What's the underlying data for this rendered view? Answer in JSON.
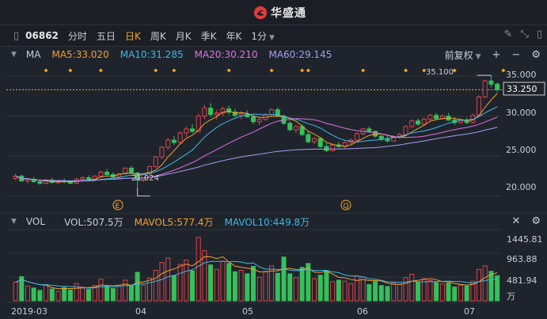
{
  "brand": {
    "name": "华盛通",
    "logo_icon": "huasheng-logo-icon"
  },
  "toolbar": {
    "code": "06862",
    "periods": [
      "分时",
      "五日",
      "日K",
      "周K",
      "月K",
      "季K",
      "年K"
    ],
    "active_period": "日K",
    "minute_select": "1分",
    "icons": [
      "pencil-icon",
      "fullscreen-icon",
      "expand-icon"
    ]
  },
  "main_panel": {
    "indicator": "MA",
    "ma": [
      {
        "label": "MA5:33.020",
        "color": "#f0a030"
      },
      {
        "label": "MA10:31.285",
        "color": "#3db8e8"
      },
      {
        "label": "MA20:30.210",
        "color": "#e36ee3"
      },
      {
        "label": "MA60:29.145",
        "color": "#a39cf0"
      }
    ],
    "adjust": "前复权",
    "y_ticks": [
      "35.000",
      "30.000",
      "25.000",
      "20.000"
    ],
    "current_price": "33.250",
    "high_label": "35.100",
    "low_label": "21.024",
    "event_markers": [
      "E",
      "Q"
    ]
  },
  "volume_panel": {
    "indicator": "VOL",
    "vol": {
      "label": "VOL:507.5万",
      "color": "#c9cdd4"
    },
    "mavol5": {
      "label": "MAVOL5:577.4万",
      "color": "#f0a030"
    },
    "mavol10": {
      "label": "MAVOL10:449.8万",
      "color": "#3db8e8"
    },
    "y_ticks": [
      "1445.81",
      "963.88",
      "481.94"
    ],
    "unit": "万"
  },
  "x_axis": {
    "labels": [
      "2019-03",
      "04",
      "05",
      "06",
      "07"
    ]
  },
  "colors": {
    "up": "#e0434c",
    "down": "#35c05a",
    "background": "#1f242c",
    "orange": "#f5a623"
  },
  "chart_data": {
    "type": "candlestick",
    "ylim": [
      18.0,
      36.6
    ],
    "candles": [
      [
        22.2,
        22.8,
        22.0,
        22.5
      ],
      [
        22.5,
        22.7,
        21.8,
        21.9
      ],
      [
        21.9,
        22.3,
        21.6,
        22.1
      ],
      [
        22.1,
        22.4,
        21.7,
        21.8
      ],
      [
        21.8,
        22.1,
        21.4,
        21.6
      ],
      [
        21.6,
        22.2,
        21.5,
        22.0
      ],
      [
        22.0,
        22.3,
        21.6,
        21.7
      ],
      [
        21.7,
        22.0,
        21.5,
        21.9
      ],
      [
        21.9,
        22.2,
        21.6,
        21.8
      ],
      [
        21.8,
        22.0,
        21.5,
        21.6
      ],
      [
        21.6,
        22.3,
        21.5,
        22.1
      ],
      [
        22.1,
        22.5,
        21.9,
        22.3
      ],
      [
        22.3,
        22.6,
        22.0,
        22.1
      ],
      [
        22.1,
        22.6,
        22.0,
        22.5
      ],
      [
        22.5,
        23.2,
        22.4,
        23.0
      ],
      [
        23.0,
        23.4,
        22.6,
        22.7
      ],
      [
        22.7,
        23.0,
        22.2,
        22.4
      ],
      [
        22.4,
        22.9,
        22.2,
        22.8
      ],
      [
        22.8,
        23.6,
        22.7,
        23.5
      ],
      [
        23.5,
        23.8,
        22.8,
        22.9
      ],
      [
        22.9,
        23.0,
        21.0,
        22.0
      ],
      [
        22.0,
        22.9,
        21.8,
        22.8
      ],
      [
        22.8,
        23.8,
        22.6,
        23.7
      ],
      [
        23.7,
        25.0,
        23.5,
        24.9
      ],
      [
        24.9,
        26.3,
        24.6,
        26.1
      ],
      [
        26.1,
        27.3,
        25.8,
        27.0
      ],
      [
        27.0,
        27.5,
        26.4,
        26.7
      ],
      [
        26.7,
        28.1,
        26.5,
        27.9
      ],
      [
        27.9,
        28.7,
        27.4,
        28.4
      ],
      [
        28.4,
        29.0,
        27.9,
        28.1
      ],
      [
        28.1,
        30.3,
        28.0,
        30.0
      ],
      [
        30.0,
        31.4,
        29.6,
        31.0
      ],
      [
        31.0,
        31.6,
        29.9,
        30.2
      ],
      [
        30.2,
        30.8,
        29.6,
        30.4
      ],
      [
        30.4,
        31.2,
        30.0,
        30.9
      ],
      [
        30.9,
        31.3,
        30.2,
        30.5
      ],
      [
        30.5,
        30.9,
        29.9,
        30.1
      ],
      [
        30.1,
        30.6,
        29.6,
        30.3
      ],
      [
        30.3,
        30.7,
        29.8,
        29.9
      ],
      [
        29.9,
        30.1,
        29.0,
        29.3
      ],
      [
        29.3,
        29.8,
        28.9,
        29.6
      ],
      [
        29.6,
        30.4,
        29.4,
        30.2
      ],
      [
        30.2,
        31.0,
        30.0,
        30.8
      ],
      [
        30.8,
        31.1,
        29.9,
        30.0
      ],
      [
        30.0,
        30.2,
        28.9,
        29.1
      ],
      [
        29.1,
        29.4,
        28.1,
        28.3
      ],
      [
        28.3,
        28.9,
        27.9,
        28.7
      ],
      [
        28.7,
        29.0,
        27.5,
        27.7
      ],
      [
        27.7,
        28.1,
        26.6,
        26.8
      ],
      [
        26.8,
        27.4,
        26.5,
        27.2
      ],
      [
        27.2,
        27.3,
        26.0,
        26.2
      ],
      [
        26.2,
        26.7,
        25.5,
        25.7
      ],
      [
        25.7,
        26.6,
        25.6,
        26.4
      ],
      [
        26.4,
        26.8,
        26.0,
        26.2
      ],
      [
        26.2,
        26.9,
        26.0,
        26.7
      ],
      [
        26.7,
        27.2,
        26.5,
        27.0
      ],
      [
        27.0,
        28.0,
        26.9,
        27.8
      ],
      [
        27.8,
        28.6,
        27.6,
        28.4
      ],
      [
        28.4,
        28.7,
        27.9,
        28.1
      ],
      [
        28.1,
        28.2,
        27.3,
        27.5
      ],
      [
        27.5,
        27.6,
        26.9,
        27.1
      ],
      [
        27.1,
        27.5,
        26.7,
        26.9
      ],
      [
        26.9,
        27.6,
        26.8,
        27.4
      ],
      [
        27.4,
        27.9,
        27.2,
        27.7
      ],
      [
        27.7,
        28.9,
        27.6,
        28.7
      ],
      [
        28.7,
        29.6,
        28.5,
        29.4
      ],
      [
        29.4,
        29.7,
        28.8,
        29.0
      ],
      [
        29.0,
        29.8,
        28.9,
        29.6
      ],
      [
        29.6,
        30.3,
        29.4,
        30.1
      ],
      [
        30.1,
        30.4,
        29.5,
        29.7
      ],
      [
        29.7,
        30.2,
        29.6,
        30.0
      ],
      [
        30.0,
        30.4,
        29.4,
        29.5
      ],
      [
        29.5,
        29.9,
        28.9,
        29.2
      ],
      [
        29.2,
        29.7,
        29.0,
        29.5
      ],
      [
        29.5,
        29.8,
        29.0,
        29.2
      ],
      [
        29.2,
        30.3,
        29.1,
        30.1
      ],
      [
        30.1,
        32.6,
        30.0,
        32.4
      ],
      [
        32.4,
        34.6,
        32.2,
        34.4
      ],
      [
        34.4,
        35.1,
        33.6,
        34.0
      ],
      [
        34.0,
        34.2,
        33.0,
        33.3
      ]
    ],
    "volume": [
      3.8,
      4.9,
      3.0,
      2.6,
      2.1,
      3.3,
      2.4,
      1.9,
      2.7,
      2.2,
      3.5,
      2.8,
      2.3,
      3.1,
      4.4,
      3.0,
      2.5,
      2.9,
      4.2,
      3.1,
      5.8,
      3.2,
      4.6,
      6.2,
      7.8,
      8.7,
      5.1,
      7.4,
      8.3,
      6.1,
      12.9,
      10.2,
      7.3,
      6.4,
      8.0,
      7.6,
      5.9,
      6.2,
      5.5,
      7.0,
      4.8,
      6.0,
      7.1,
      5.6,
      8.9,
      5.5,
      4.7,
      6.8,
      7.6,
      4.5,
      5.2,
      6.1,
      3.9,
      4.2,
      4.0,
      3.5,
      5.0,
      4.8,
      3.3,
      3.9,
      3.1,
      2.9,
      3.6,
      3.3,
      4.7,
      5.4,
      3.8,
      4.5,
      4.1,
      3.7,
      3.4,
      3.6,
      2.8,
      3.2,
      3.0,
      4.0,
      6.4,
      7.1,
      6.0,
      5.1
    ],
    "vol_ylim": [
      0,
      14.5
    ],
    "marker_positions": [
      5,
      9,
      14,
      23,
      26,
      35,
      42,
      47,
      48,
      57,
      64,
      67,
      72,
      80
    ]
  }
}
